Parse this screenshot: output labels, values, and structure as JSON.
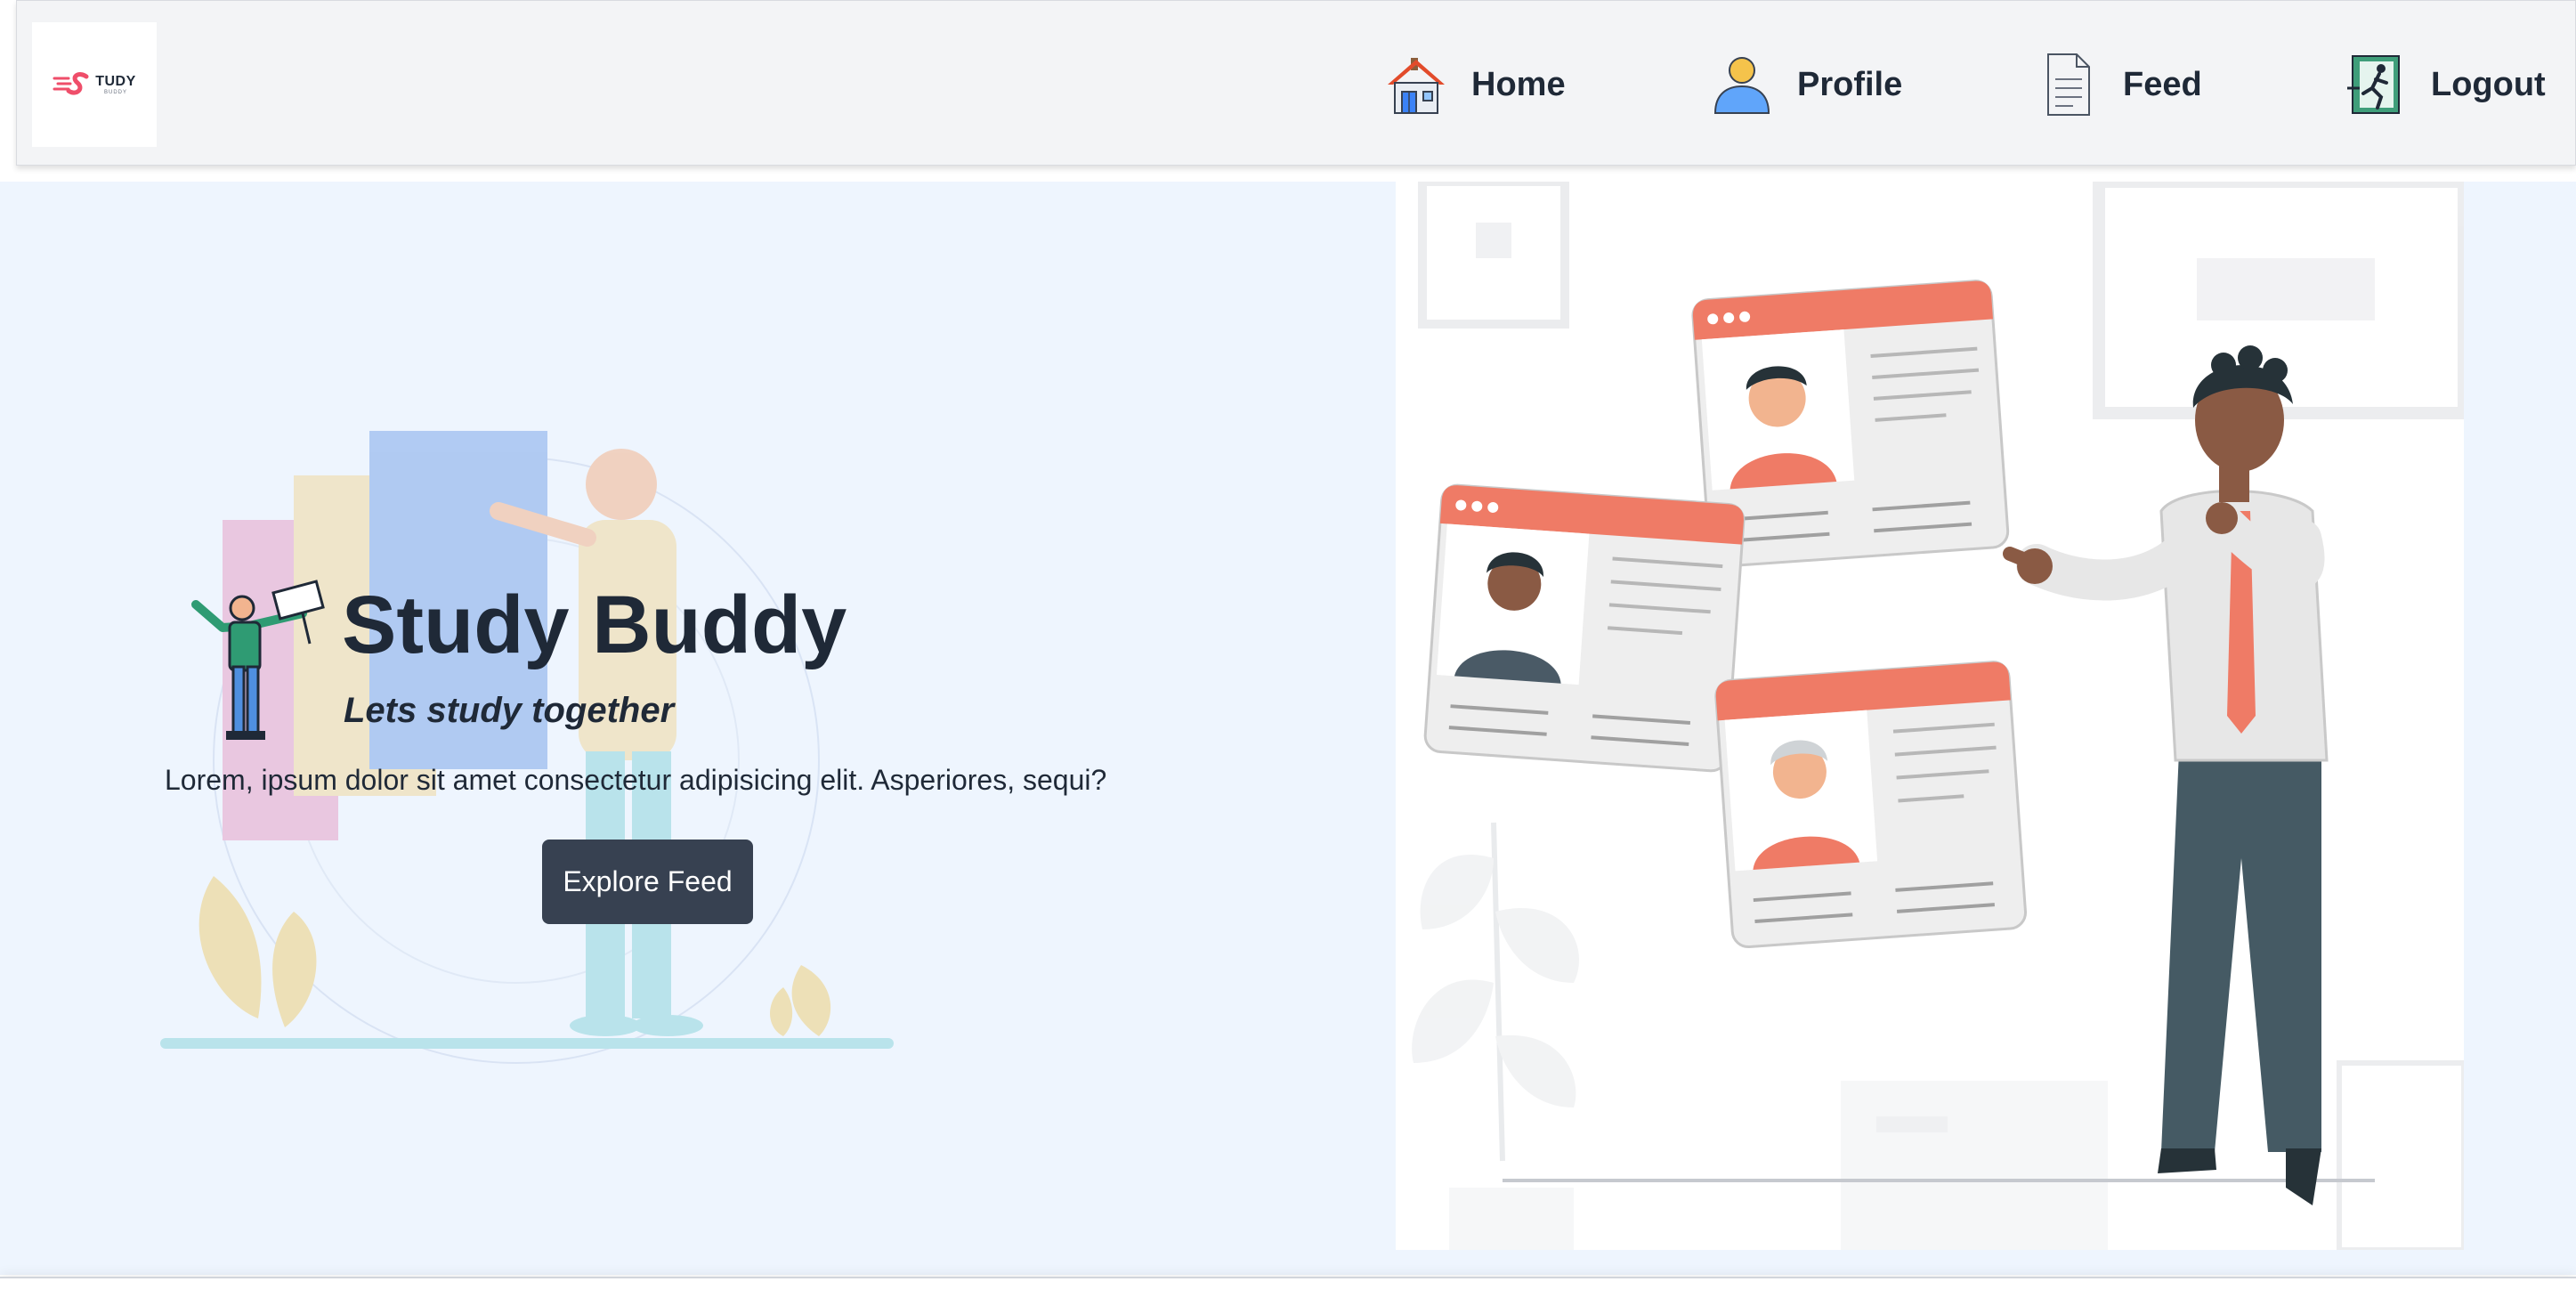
{
  "navbar": {
    "logo": {
      "text": "TUDY",
      "sub": "BUDDY"
    },
    "items": [
      {
        "label": "Home",
        "icon": "home-icon"
      },
      {
        "label": "Profile",
        "icon": "user-icon"
      },
      {
        "label": "Feed",
        "icon": "document-icon"
      },
      {
        "label": "Logout",
        "icon": "logout-icon"
      }
    ]
  },
  "hero": {
    "title": "Study Buddy",
    "subtitle": "Lets study together",
    "description": "Lorem, ipsum dolor sit amet consectetur adipisicing elit. Asperiores, sequi?",
    "button_label": "Explore Feed"
  },
  "colors": {
    "hero_bg": "#eef5fe",
    "navbar_bg": "#f3f4f6",
    "button_bg": "#374151",
    "accent_coral": "#ef7b66",
    "text_dark": "#1f2937"
  }
}
